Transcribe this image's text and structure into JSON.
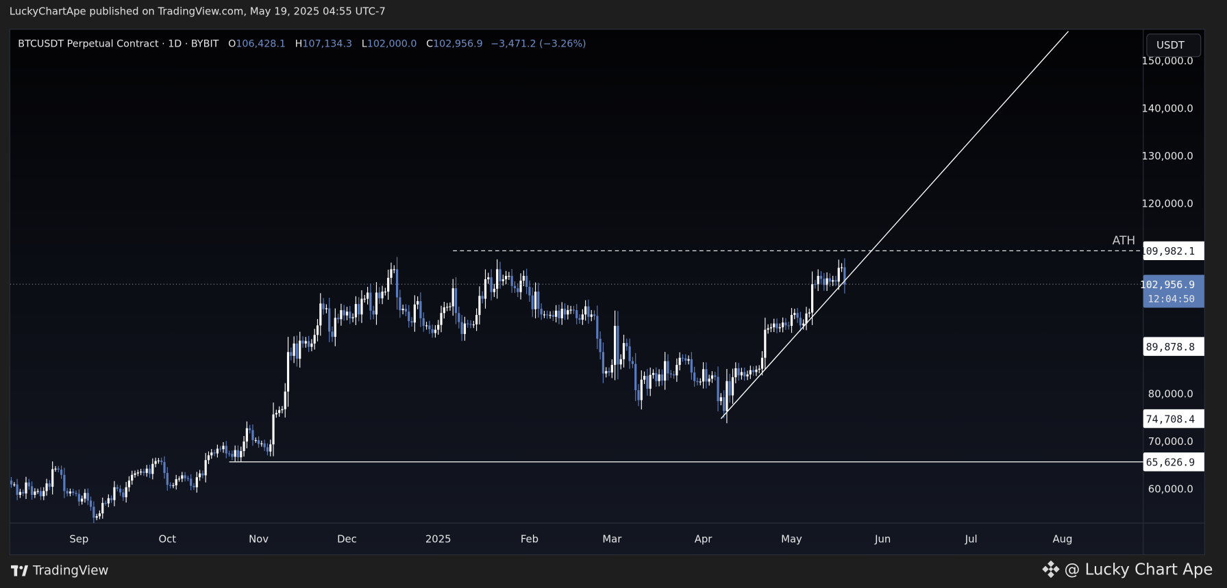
{
  "publisher_line": "LuckyChartApe published on TradingView.com, May 19, 2025 04:55 UTC-7",
  "legend": {
    "symbol": "BTCUSDT Perpetual Contract · 1D · BYBIT",
    "open_label": "O",
    "open": "106,428.1",
    "high_label": "H",
    "high": "107,134.3",
    "low_label": "L",
    "low": "102,000.0",
    "close_label": "C",
    "close": "102,956.9",
    "change": "−3,471.2 (−3.26%)"
  },
  "currency_button": "USDT",
  "footer": {
    "brand": "TradingView",
    "author": "@ Lucky Chart Ape"
  },
  "colors": {
    "up": "#ffffff",
    "down": "#5b7cbf",
    "last_price_badge": "#5b7bb5",
    "line": "#ffffff"
  },
  "chart_data": {
    "type": "candlestick",
    "start_date": "2024-08-08",
    "interval": "1D",
    "ylim": [
      50000,
      160000
    ],
    "y_scale": "linear",
    "y_ticks": [
      {
        "value": 150000,
        "label": "150,000.0"
      },
      {
        "value": 140000,
        "label": "140,000.0"
      },
      {
        "value": 130000,
        "label": "130,000.0"
      },
      {
        "value": 120000,
        "label": "120,000.0"
      },
      {
        "value": 80000,
        "label": "80,000.0"
      },
      {
        "value": 70000,
        "label": "70,000.0"
      },
      {
        "value": 60000,
        "label": "60,000.0"
      }
    ],
    "x_ticks": [
      {
        "date": "2024-09-01",
        "label": "Sep"
      },
      {
        "date": "2024-10-01",
        "label": "Oct"
      },
      {
        "date": "2024-11-01",
        "label": "Nov"
      },
      {
        "date": "2024-12-01",
        "label": "Dec"
      },
      {
        "date": "2025-01-01",
        "label": "2025"
      },
      {
        "date": "2025-02-01",
        "label": "Feb"
      },
      {
        "date": "2025-03-01",
        "label": "Mar"
      },
      {
        "date": "2025-04-01",
        "label": "Apr"
      },
      {
        "date": "2025-05-01",
        "label": "May"
      },
      {
        "date": "2025-06-01",
        "label": "Jun"
      },
      {
        "date": "2025-07-01",
        "label": "Jul"
      },
      {
        "date": "2025-08-01",
        "label": "Aug"
      }
    ],
    "closes": [
      61700,
      60900,
      60900,
      58700,
      59300,
      59000,
      61300,
      60500,
      58700,
      59400,
      59500,
      58400,
      59500,
      61100,
      60400,
      64100,
      64200,
      64000,
      62900,
      59500,
      59000,
      59400,
      59100,
      58900,
      57300,
      57900,
      59100,
      57500,
      56200,
      53900,
      54200,
      54800,
      57000,
      56900,
      58000,
      57600,
      60300,
      60000,
      59200,
      58200,
      60300,
      61700,
      62900,
      63200,
      63400,
      63600,
      63300,
      64200,
      63100,
      65200,
      65800,
      65900,
      65600,
      63300,
      60800,
      60600,
      60700,
      62000,
      62100,
      62800,
      62200,
      62100,
      60600,
      60300,
      62400,
      63200,
      62800,
      66000,
      67000,
      67600,
      67400,
      68400,
      68300,
      69000,
      67400,
      67300,
      66700,
      68100,
      66600,
      67900,
      69900,
      72700,
      72300,
      70200,
      70200,
      69400,
      69500,
      68700,
      67800,
      69300,
      75600,
      75900,
      76500,
      76700,
      80400,
      88700,
      87900,
      90500,
      87300,
      91100,
      90500,
      91000,
      89800,
      90500,
      92300,
      94300,
      98900,
      97700,
      97900,
      93000,
      91900,
      95900,
      95600,
      97500,
      96400,
      97200,
      95800,
      96000,
      98800,
      96600,
      99900,
      99900,
      101200,
      97400,
      96600,
      101200,
      100000,
      101400,
      101400,
      104300,
      106100,
      106100,
      100200,
      97500,
      97800,
      97200,
      95200,
      94900,
      98700,
      99400,
      95800,
      94200,
      94300,
      93500,
      92700,
      93400,
      94400,
      96900,
      98100,
      98200,
      98300,
      102100,
      96900,
      95000,
      92500,
      94700,
      94600,
      94500,
      94500,
      96500,
      100500,
      99900,
      104000,
      104400,
      101300,
      102000,
      106100,
      103600,
      104000,
      104700,
      104700,
      102600,
      102100,
      101300,
      103700,
      104700,
      102400,
      100600,
      97700,
      101400,
      97800,
      96600,
      96600,
      96500,
      96500,
      96100,
      97400,
      95800,
      97800,
      96600,
      97500,
      97600,
      97500,
      95800,
      95500,
      96600,
      98300,
      96100,
      96600,
      96300,
      91500,
      88700,
      84200,
      84700,
      84400,
      86000,
      94200,
      86100,
      87200,
      90600,
      89900,
      86800,
      86200,
      80700,
      78600,
      82900,
      83700,
      81000,
      83900,
      84300,
      82600,
      84000,
      82700,
      86800,
      84200,
      84000,
      83800,
      86000,
      87500,
      87400,
      86900,
      87200,
      84400,
      82600,
      82400,
      82500,
      85100,
      82500,
      83100,
      83800,
      83500,
      78400,
      79200,
      76300,
      82600,
      79600,
      83400,
      85300,
      83800,
      84500,
      83600,
      84000,
      84900,
      84500,
      85000,
      85200,
      87500,
      93400,
      93700,
      93900,
      94700,
      93700,
      93900,
      94900,
      94300,
      94200,
      96500,
      96900,
      95900,
      94300,
      94700,
      96800,
      97000,
      103000,
      102900,
      104700,
      104100,
      102800,
      104200,
      103500,
      103800,
      103500,
      106400,
      106500,
      102900
    ],
    "drawings": {
      "trendline": {
        "from": {
          "date": "2025-04-07",
          "price": 74708.4
        },
        "to": {
          "date": "2025-08-03",
          "price": 156100
        }
      },
      "support_line": {
        "from_date": "2024-10-22",
        "price": 65626.9
      },
      "ath_line": {
        "from_date": "2025-01-06",
        "price": 109982.1,
        "label": "ATH",
        "style": "dashed"
      },
      "last_price_line": {
        "price": 102956.9,
        "style": "dotted"
      }
    },
    "price_badges": [
      {
        "label": "109,982.1",
        "value": 109982.1,
        "style": "white"
      },
      {
        "label": "102,956.9",
        "value": 102956.9,
        "style": "last",
        "countdown": "12:04:50"
      },
      {
        "label": "89,878.8",
        "value": 89878.8,
        "style": "white"
      },
      {
        "label": "74,708.4",
        "value": 74708.4,
        "style": "white"
      },
      {
        "label": "65,626.9",
        "value": 65626.9,
        "style": "white"
      }
    ]
  }
}
